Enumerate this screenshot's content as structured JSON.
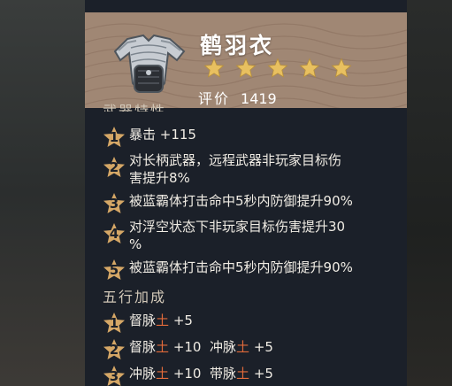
{
  "item": {
    "name": "鹤羽衣",
    "stars": 5,
    "rating_label": "评价",
    "rating_value": "1419",
    "icon": "armor-icon"
  },
  "sections": {
    "weapon_traits_title": "武器特性",
    "five_elements_title": "五行加成"
  },
  "traits": [
    {
      "num": "1",
      "text": "暴击 +115"
    },
    {
      "num": "2",
      "line1": "对长柄武器，远程武器非玩家目标伤",
      "line2": "害提升8%"
    },
    {
      "num": "3",
      "text": "被蓝霸体打击命中5秒内防御提升90%"
    },
    {
      "num": "4",
      "line1": "对浮空状态下非玩家目标伤害提升30",
      "line2": "%"
    },
    {
      "num": "5",
      "text": "被蓝霸体打击命中5秒内防御提升90%"
    }
  ],
  "elements": [
    {
      "num": "1",
      "a_name": "督脉",
      "a_el": "土",
      "a_val": "+5"
    },
    {
      "num": "2",
      "a_name": "督脉",
      "a_el": "土",
      "a_val": "+10",
      "b_name": "冲脉",
      "b_el": "土",
      "b_val": "+5"
    },
    {
      "num": "3",
      "a_name": "冲脉",
      "a_el": "土",
      "a_val": "+10",
      "b_name": "带脉",
      "b_el": "土",
      "b_val": "+5"
    }
  ],
  "colors": {
    "header": "#a08774",
    "panel": "#1b2029",
    "badge": "#d5a766",
    "earth": "#e06a3a"
  }
}
